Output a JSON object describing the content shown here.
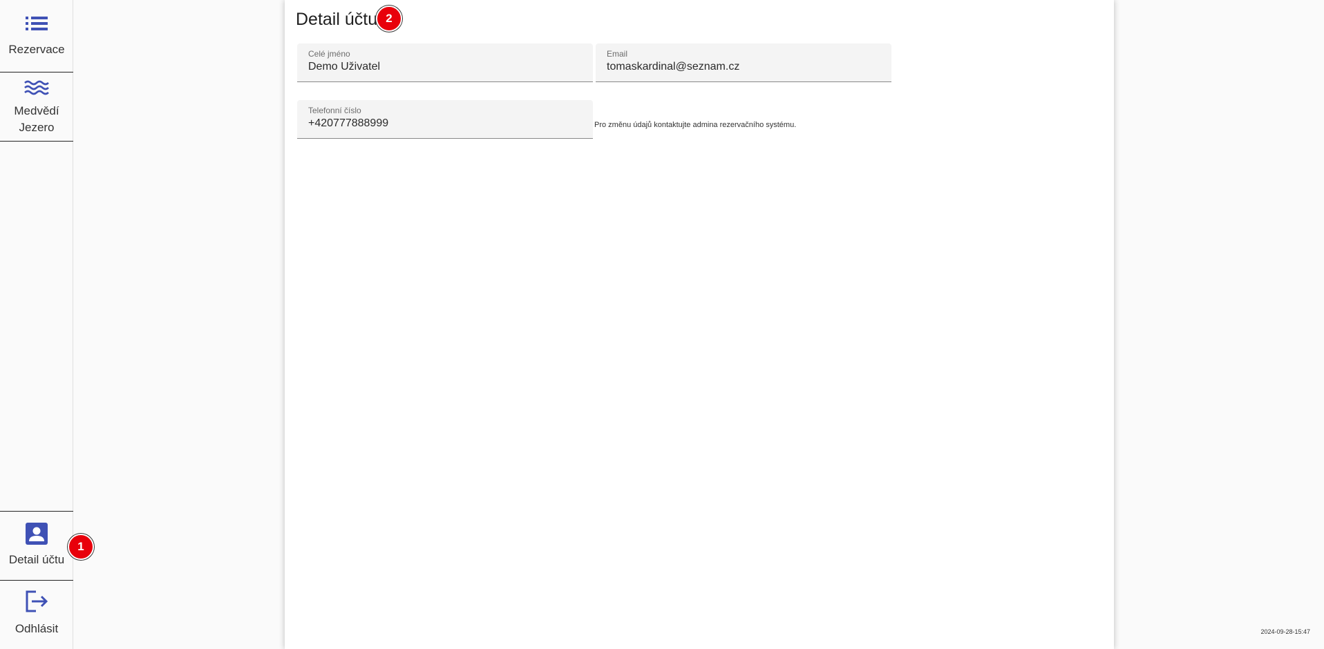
{
  "sidebar": {
    "items": [
      {
        "label": "Rezervace",
        "icon": "list-icon"
      },
      {
        "label": "Medvědí Jezero",
        "icon": "waves-icon"
      },
      {
        "label": "Detail účtu",
        "icon": "account-box-icon"
      },
      {
        "label": "Odhlásit",
        "icon": "logout-icon"
      }
    ]
  },
  "badges": {
    "first": "1",
    "second": "2"
  },
  "main": {
    "title": "Detail účtu",
    "fields": {
      "name": {
        "label": "Celé jméno",
        "value": "Demo Uživatel"
      },
      "email": {
        "label": "Email",
        "value": "tomaskardinal@seznam.cz"
      },
      "phone": {
        "label": "Telefonní číslo",
        "value": "+420777888999"
      }
    },
    "note": "Pro změnu údajů kontaktujte admina rezervačního systému."
  },
  "timestamp": "2024-09-28-15:47",
  "colors": {
    "accent": "#3f51b5",
    "badge": "#e8000b",
    "field_bg": "#f4f4f4"
  }
}
